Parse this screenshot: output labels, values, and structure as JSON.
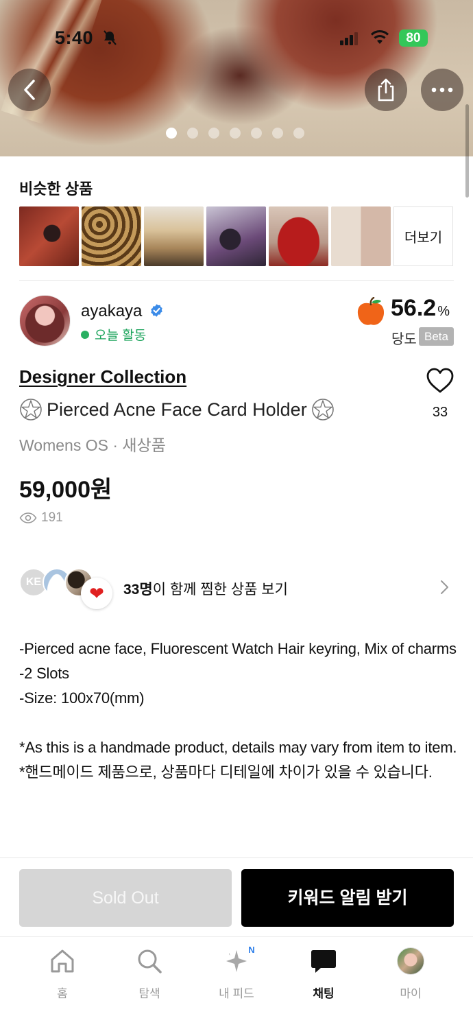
{
  "status_bar": {
    "time": "5:40",
    "battery": "80"
  },
  "hero": {
    "icons": {
      "back": "chevron-left-icon",
      "share": "share-icon",
      "more": "more-horizontal-icon"
    },
    "image_count": 7,
    "active_index": 0
  },
  "similar": {
    "title": "비슷한 상품",
    "more_label": "더보기",
    "thumbnail_count": 6
  },
  "seller": {
    "name": "ayakaya",
    "verified": true,
    "activity": "오늘 활동",
    "sweetness_value": "56.2",
    "sweetness_unit": "%",
    "sweetness_label": "당도",
    "beta_label": "Beta"
  },
  "product": {
    "brand": "Designer Collection",
    "title": "Pierced Acne Face Card Holder",
    "category": "Womens OS · 새상품",
    "price": "59,000원",
    "views": "191",
    "likes": "33"
  },
  "wishlist": {
    "avatar_initials": "KE",
    "count_text": "33명",
    "rest_text": "이 함께 찜한 상품 보기"
  },
  "description": "-Pierced acne face, Fluorescent Watch Hair keyring, Mix of charms\n-2 Slots\n-Size: 100x70(mm)\n\n*As this is a handmade product, details may vary from item to item.\n*핸드메이드 제품으로, 상품마다 디테일에 차이가 있을 수 있습니다.",
  "actions": {
    "sold_out": "Sold Out",
    "keyword_alert": "키워드 알림 받기"
  },
  "tabbar": {
    "home": "홈",
    "search": "탐색",
    "feed": "내 피드",
    "feed_badge": "N",
    "chat": "채팅",
    "my": "마이",
    "active": "chat"
  },
  "colors": {
    "activity_green": "#1aa35a",
    "battery_green": "#33c759",
    "primary_button": "#000000",
    "disabled_button": "#d6d6d6"
  }
}
